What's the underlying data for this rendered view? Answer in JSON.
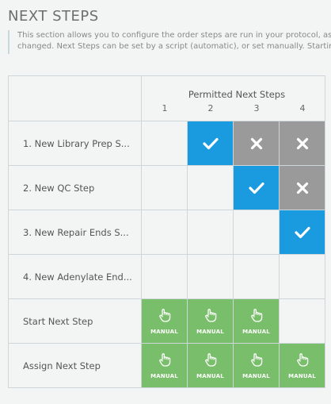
{
  "section": {
    "title": "NEXT STEPS",
    "description_lines": [
      "This section allows you to configure the order steps are run in your protocol, as well",
      "changed. Next Steps can be set by a script (automatic), or set manually. Starting Ne"
    ]
  },
  "matrix": {
    "header_title": "Permitted Next Steps",
    "columns": [
      "1",
      "2",
      "3",
      "4"
    ],
    "rows": [
      {
        "label": "1. New Library Prep S...",
        "cells": [
          "empty",
          "check",
          "cross",
          "cross"
        ]
      },
      {
        "label": "2. New QC Step",
        "cells": [
          "empty",
          "empty",
          "check",
          "cross"
        ]
      },
      {
        "label": "3. New Repair Ends S...",
        "cells": [
          "empty",
          "empty",
          "empty",
          "check"
        ]
      },
      {
        "label": "4. New Adenylate End...",
        "cells": [
          "empty",
          "empty",
          "empty",
          "empty"
        ]
      }
    ],
    "action_rows": [
      {
        "label": "Start Next Step",
        "cells": [
          "MANUAL",
          "MANUAL",
          "MANUAL",
          ""
        ]
      },
      {
        "label": "Assign Next Step",
        "cells": [
          "MANUAL",
          "MANUAL",
          "MANUAL",
          "MANUAL"
        ]
      }
    ]
  },
  "colors": {
    "check": "#1a9be0",
    "cross": "#9a9a9a",
    "manual": "#79be6a"
  },
  "icons": {
    "check": "check-icon",
    "cross": "close-icon",
    "manual": "hand-pointer-icon"
  }
}
